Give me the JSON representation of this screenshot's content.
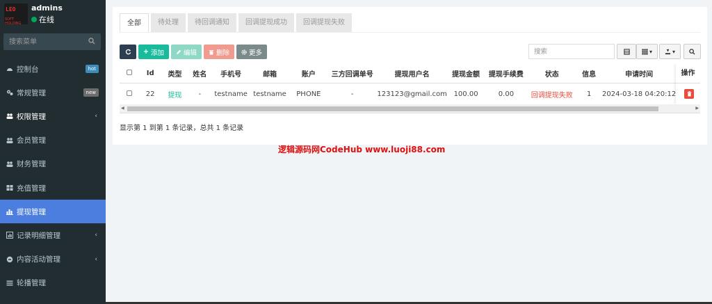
{
  "colors": {
    "sidebar_bg": "#222d32",
    "active_menu": "#4c7ee0",
    "accent_green": "#00a65a",
    "accent_red": "#e74c3c",
    "accent_teal": "#18bc9c"
  },
  "user": {
    "name": "admins",
    "status": "在线",
    "logo_text": "LEO",
    "logo_sub": "SOFT HOLDING"
  },
  "search": {
    "placeholder": "搜索菜单"
  },
  "menu": [
    {
      "label": "控制台",
      "icon": "dashboard-icon",
      "badge": "hot"
    },
    {
      "label": "常规管理",
      "icon": "cogs-icon",
      "badge": "new"
    },
    {
      "label": "权限管理",
      "icon": "group-icon",
      "chevron": true
    },
    {
      "label": "会员管理",
      "icon": "users-icon"
    },
    {
      "label": "财务管理",
      "icon": "users-icon"
    },
    {
      "label": "充值管理",
      "icon": "grid-icon"
    },
    {
      "label": "提现管理",
      "icon": "bar-chart-icon",
      "active": true
    },
    {
      "label": "记录明细管理",
      "icon": "line-chart-icon",
      "chevron": true
    },
    {
      "label": "内容活动管理",
      "icon": "circle-icon",
      "chevron": true
    },
    {
      "label": "轮播管理",
      "icon": "list-icon"
    }
  ],
  "tabs": [
    "全部",
    "待处理",
    "待回调通知",
    "回调提现成功",
    "回调提现失败"
  ],
  "toolbar": {
    "add": "添加",
    "edit": "编辑",
    "delete": "删除",
    "more": "更多",
    "search_placeholder": "搜索"
  },
  "table": {
    "headers": [
      "Id",
      "类型",
      "姓名",
      "手机号",
      "邮箱",
      "账户",
      "三方回调单号",
      "提现用户名",
      "提现金额",
      "提现手续费",
      "状态",
      "信息",
      "申请时间"
    ],
    "op_header": "操作",
    "rows": [
      [
        "22",
        "提现",
        "-",
        "testname",
        "testname",
        "PHONE",
        "-",
        "123123@gmail.com",
        "100.00",
        "0.00",
        "回调提现失败",
        "1",
        "2024-03-18 04:20:12"
      ]
    ]
  },
  "footer": "显示第 1 到第 1 条记录，总共 1 条记录",
  "watermark": "逻辑源码网CodeHub  www.luoji88.com"
}
